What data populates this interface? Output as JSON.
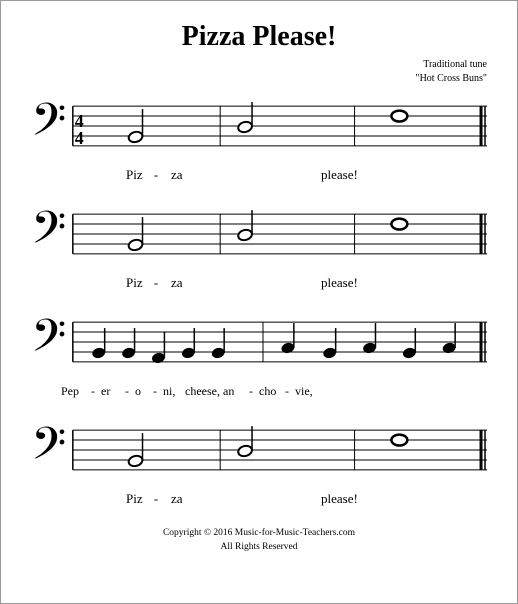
{
  "title": "Pizza Please!",
  "attribution": {
    "line1": "Traditional tune",
    "line2": "\"Hot Cross Buns\""
  },
  "systems": [
    {
      "id": "system1",
      "hasTimeSig": true,
      "lyrics": [
        "Piz",
        "-",
        "za",
        "",
        "please!"
      ]
    },
    {
      "id": "system2",
      "hasTimeSig": false,
      "lyrics": [
        "Piz",
        "-",
        "za",
        "",
        "please!"
      ]
    },
    {
      "id": "system3",
      "hasTimeSig": false,
      "lyrics": [
        "Pep",
        "-",
        "er",
        "-",
        "o",
        "-",
        "ni,",
        "cheese,",
        "an",
        "-",
        "cho",
        "-",
        "vie,"
      ]
    },
    {
      "id": "system4",
      "hasTimeSig": false,
      "lyrics": [
        "Piz",
        "-",
        "za",
        "",
        "please!"
      ]
    }
  ],
  "copyright": {
    "line1": "Copyright © 2016  Music-for-Music-Teachers.com",
    "line2": "All Rights Reserved"
  }
}
